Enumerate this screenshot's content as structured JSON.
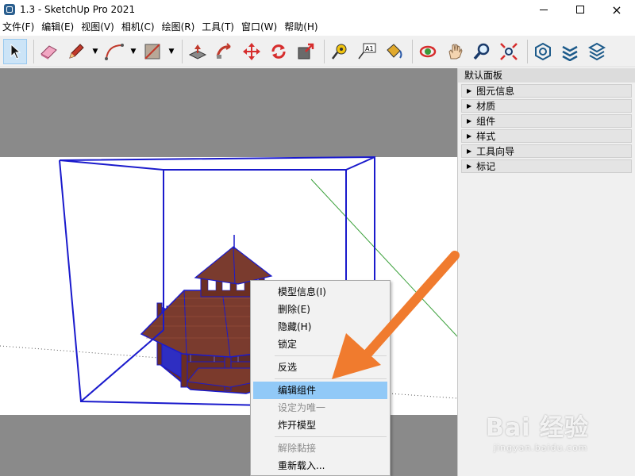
{
  "window": {
    "title": "1.3 - SketchUp Pro 2021",
    "close_glyph": "×"
  },
  "menu": [
    "文件(F)",
    "编辑(E)",
    "视图(V)",
    "相机(C)",
    "绘图(R)",
    "工具(T)",
    "窗口(W)",
    "帮助(H)"
  ],
  "toolbar": {
    "buttons": [
      {
        "name": "select-icon",
        "active": true
      },
      {
        "name": "eraser-icon"
      },
      {
        "name": "pencil-icon",
        "dropdown": true
      },
      {
        "name": "arc-icon",
        "dropdown": true
      },
      {
        "name": "rectangle-icon",
        "dropdown": true
      },
      {
        "name": "push-pull-icon"
      },
      {
        "name": "follow-me-icon"
      },
      {
        "name": "move-icon"
      },
      {
        "name": "rotate-icon"
      },
      {
        "name": "scale-icon"
      },
      {
        "name": "tape-measure-icon"
      },
      {
        "name": "text-label-icon"
      },
      {
        "name": "paint-bucket-icon"
      },
      {
        "name": "orbit-icon"
      },
      {
        "name": "pan-icon"
      },
      {
        "name": "zoom-icon"
      },
      {
        "name": "zoom-extents-icon"
      },
      {
        "name": "warehouse-icon"
      },
      {
        "name": "extension-warehouse-icon"
      },
      {
        "name": "layout-icon"
      }
    ],
    "text_tool_label": "A1"
  },
  "panel": {
    "title": "默认面板",
    "trays": [
      "图元信息",
      "材质",
      "组件",
      "样式",
      "工具向导",
      "标记"
    ]
  },
  "context_menu": {
    "groups": [
      [
        {
          "label": "模型信息(I)",
          "enabled": true
        },
        {
          "label": "删除(E)",
          "enabled": true
        },
        {
          "label": "隐藏(H)",
          "enabled": true
        },
        {
          "label": "锁定",
          "enabled": true
        }
      ],
      [
        {
          "label": "反选",
          "enabled": true
        }
      ],
      [
        {
          "label": "编辑组件",
          "enabled": true,
          "highlighted": true
        },
        {
          "label": "设定为唯一",
          "enabled": false
        },
        {
          "label": "炸开模型",
          "enabled": true
        }
      ],
      [
        {
          "label": "解除黏接",
          "enabled": false
        },
        {
          "label": "重新载入...",
          "enabled": true
        }
      ]
    ]
  },
  "watermark": {
    "logo": "Bai 经验",
    "url": "jingyan.baidu.com"
  },
  "colors": {
    "selection_blue": "#1a1acc",
    "arrow_orange": "#f07b2e",
    "highlight": "#91c9f7",
    "roof_brown": "#7a3b2e"
  }
}
